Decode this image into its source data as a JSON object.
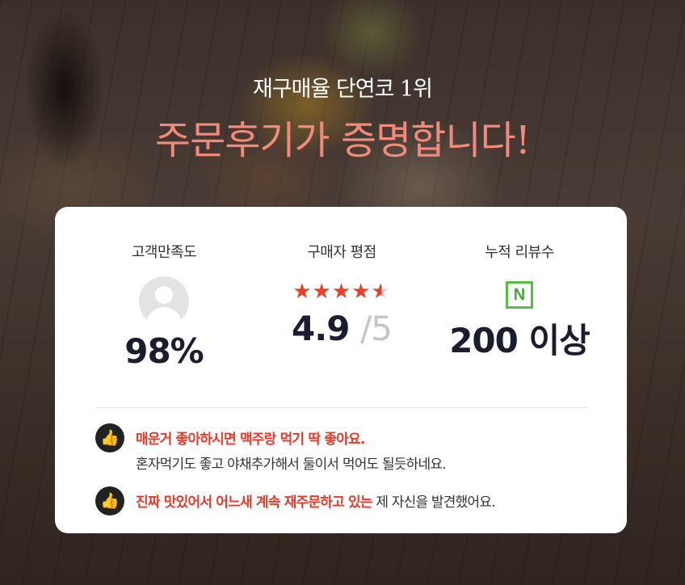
{
  "header": {
    "subtitle": "재구매율 단연코 1위",
    "headline": "주문후기가 증명합니다!"
  },
  "stats": [
    {
      "label": "고객만족도",
      "icon": "user-avatar-icon",
      "value": "98%"
    },
    {
      "label": "구매자 평점",
      "icon": "star-rating",
      "rating": 4.9,
      "value": "4.9",
      "max": "/5"
    },
    {
      "label": "누적 리뷰수",
      "icon": "naver-n-icon",
      "icon_text": "N",
      "value": "200 이상"
    }
  ],
  "reviews": [
    {
      "highlight": "매운거 좋아하시면 맥주랑 먹기 딱 좋아요.",
      "rest": "혼자먹기도 좋고 야채추가해서 둘이서 먹어도 될듯하네요."
    },
    {
      "highlight": "진짜 맛있어서 어느새 계속 재주문하고 있는",
      "rest": " 제 자신을 발견했어요."
    }
  ],
  "colors": {
    "headline": "#f08a7a",
    "highlight_red": "#e43a2a",
    "star": "#e8402a",
    "naver_green": "#5bbd45",
    "value_text": "#1a1d2e"
  }
}
